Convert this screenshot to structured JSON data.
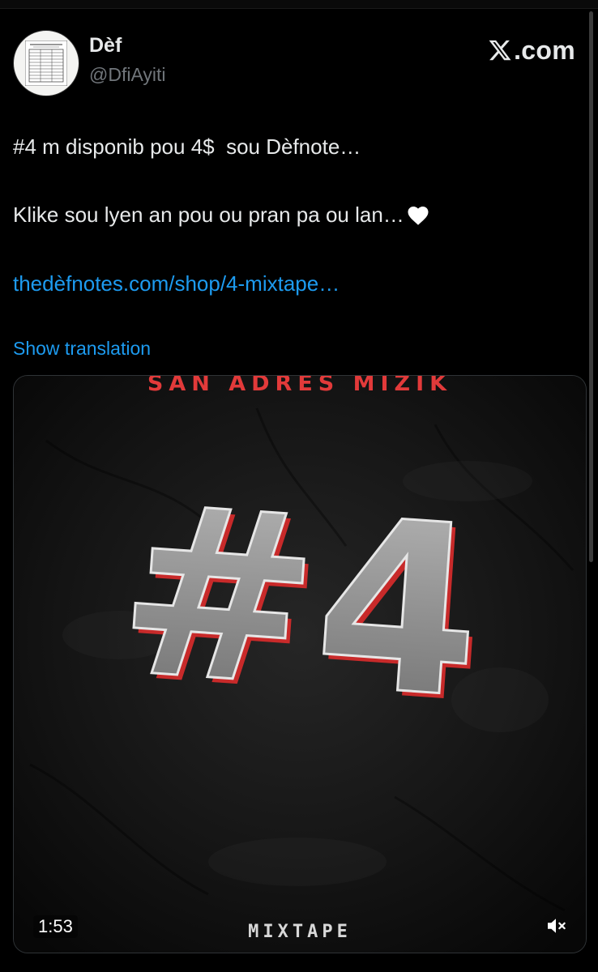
{
  "header": {
    "display_name": "Dèf",
    "handle": "@DfiAyiti",
    "brand": "X.com",
    "brand_text": ".com"
  },
  "tweet": {
    "line1": "#4 m disponib pou 4$  sou Dèfnote…",
    "line2": "Klike sou lyen an pou ou pran pa ou lan…",
    "link": "thedèfnotes.com/shop/4-mixtape…",
    "show_translation": "Show translation"
  },
  "media": {
    "artist_text": "SAN ADRES MIZIK",
    "title_text": "#4",
    "subtitle_text": "MIXTAPE",
    "time": "1:53",
    "muted": true
  },
  "icons": {
    "avatar": "document-avatar",
    "brand": "x-logo-icon",
    "heart": "white-heart-icon",
    "mute": "speaker-muted-icon"
  },
  "colors": {
    "background": "#000000",
    "text": "#e7e9ea",
    "muted_text": "#71767b",
    "link": "#1d9bf0",
    "accent_red": "#e23a3a"
  }
}
